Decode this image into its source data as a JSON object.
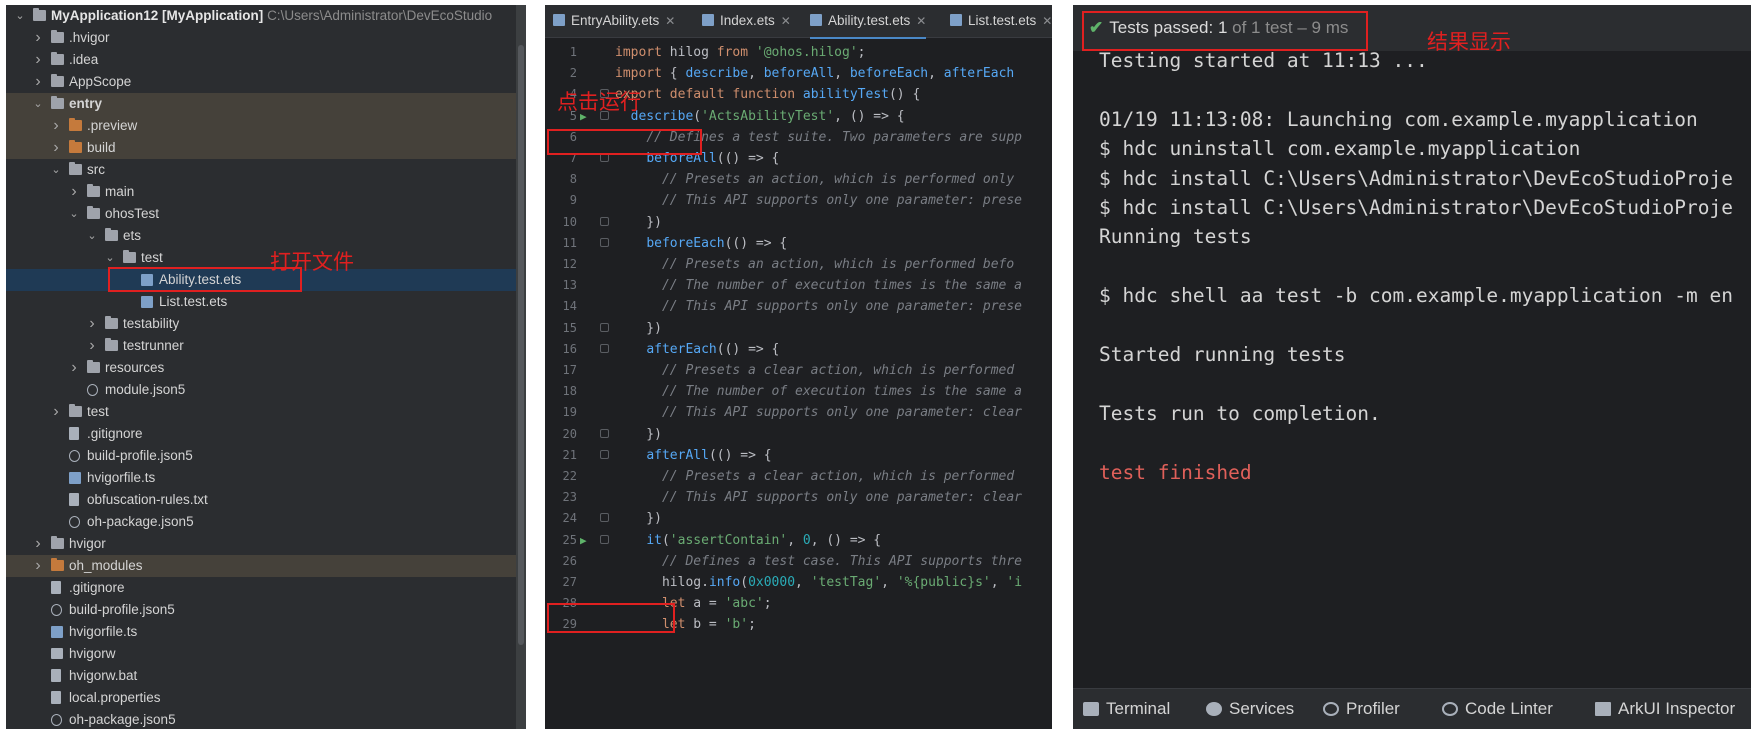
{
  "project_tree": {
    "root_name": "MyApplication12",
    "root_module": "[MyApplication]",
    "root_path": "C:\\Users\\Administrator\\DevEcoStudio",
    "items": [
      {
        "label": ".hvigor",
        "icon": "folder-icon"
      },
      {
        "label": ".idea",
        "icon": "folder-icon"
      },
      {
        "label": "AppScope",
        "icon": "folder-icon"
      },
      {
        "label": "entry",
        "icon": "folder-icon"
      },
      {
        "label": ".preview",
        "icon": "folder-orange-icon"
      },
      {
        "label": "build",
        "icon": "folder-orange-icon"
      },
      {
        "label": "src",
        "icon": "folder-icon"
      },
      {
        "label": "main",
        "icon": "folder-icon"
      },
      {
        "label": "ohosTest",
        "icon": "folder-icon"
      },
      {
        "label": "ets",
        "icon": "folder-icon"
      },
      {
        "label": "test",
        "icon": "folder-icon"
      },
      {
        "label": "Ability.test.ets",
        "icon": "ets-file-icon"
      },
      {
        "label": "List.test.ets",
        "icon": "ets-file-icon"
      },
      {
        "label": "testability",
        "icon": "folder-icon"
      },
      {
        "label": "testrunner",
        "icon": "folder-icon"
      },
      {
        "label": "resources",
        "icon": "folder-icon"
      },
      {
        "label": "module.json5",
        "icon": "json-file-icon"
      },
      {
        "label": "test",
        "icon": "folder-icon"
      },
      {
        "label": ".gitignore",
        "icon": "file-icon"
      },
      {
        "label": "build-profile.json5",
        "icon": "json-file-icon"
      },
      {
        "label": "hvigorfile.ts",
        "icon": "ts-file-icon"
      },
      {
        "label": "obfuscation-rules.txt",
        "icon": "file-icon"
      },
      {
        "label": "oh-package.json5",
        "icon": "json-file-icon"
      },
      {
        "label": "hvigor",
        "icon": "folder-icon"
      },
      {
        "label": "oh_modules",
        "icon": "folder-orange-icon"
      },
      {
        "label": ".gitignore",
        "icon": "file-icon"
      },
      {
        "label": "build-profile.json5",
        "icon": "json-file-icon"
      },
      {
        "label": "hvigorfile.ts",
        "icon": "ts-file-icon"
      },
      {
        "label": "hvigorw",
        "icon": "terminal-file-icon"
      },
      {
        "label": "hvigorw.bat",
        "icon": "file-icon"
      },
      {
        "label": "local.properties",
        "icon": "file-icon"
      },
      {
        "label": "oh-package.json5",
        "icon": "json-file-icon"
      }
    ]
  },
  "editor": {
    "tabs": [
      "EntryAbility.ets",
      "Index.ets",
      "Ability.test.ets",
      "List.test.ets"
    ],
    "active_tab": "Ability.test.ets",
    "lines": [
      {
        "n": "1",
        "code": "import hilog from '@ohos.hilog';"
      },
      {
        "n": "2",
        "code": "import { describe, beforeAll, beforeEach, afterEach"
      },
      {
        "n": "4",
        "code": "export default function abilityTest() {"
      },
      {
        "n": "5",
        "code": "  describe('ActsAbilityTest', () => {"
      },
      {
        "n": "6",
        "code": "    // Defines a test suite. Two parameters are supp"
      },
      {
        "n": "7",
        "code": "    beforeAll(() => {"
      },
      {
        "n": "8",
        "code": "      // Presets an action, which is performed only"
      },
      {
        "n": "9",
        "code": "      // This API supports only one parameter: prese"
      },
      {
        "n": "10",
        "code": "    })"
      },
      {
        "n": "11",
        "code": "    beforeEach(() => {"
      },
      {
        "n": "12",
        "code": "      // Presets an action, which is performed befo"
      },
      {
        "n": "13",
        "code": "      // The number of execution times is the same a"
      },
      {
        "n": "14",
        "code": "      // This API supports only one parameter: prese"
      },
      {
        "n": "15",
        "code": "    })"
      },
      {
        "n": "16",
        "code": "    afterEach(() => {"
      },
      {
        "n": "17",
        "code": "      // Presets a clear action, which is performed"
      },
      {
        "n": "18",
        "code": "      // The number of execution times is the same a"
      },
      {
        "n": "19",
        "code": "      // This API supports only one parameter: clear"
      },
      {
        "n": "20",
        "code": "    })"
      },
      {
        "n": "21",
        "code": "    afterAll(() => {"
      },
      {
        "n": "22",
        "code": "      // Presets a clear action, which is performed"
      },
      {
        "n": "23",
        "code": "      // This API supports only one parameter: clear"
      },
      {
        "n": "24",
        "code": "    })"
      },
      {
        "n": "25",
        "code": "    it('assertContain', 0, () => {"
      },
      {
        "n": "26",
        "code": "      // Defines a test case. This API supports thre"
      },
      {
        "n": "27",
        "code": "      hilog.info(0x0000, 'testTag', '%{public}s', 'i"
      },
      {
        "n": "28",
        "code": "      let a = 'abc';"
      },
      {
        "n": "29",
        "code": "      let b = 'b';"
      }
    ]
  },
  "test_run": {
    "status_prefix": "Tests passed:",
    "passed_count": "1",
    "status_suffix": "of 1 test – 9 ms",
    "output": [
      "Testing started at 11:13 ...",
      "",
      "01/19 11:13:08: Launching com.example.myapplication",
      "$ hdc uninstall com.example.myapplication",
      "$ hdc install C:\\Users\\Administrator\\DevEcoStudioProje",
      "$ hdc install C:\\Users\\Administrator\\DevEcoStudioProje",
      "Running tests",
      "",
      "$ hdc shell aa test -b com.example.myapplication -m en",
      "",
      "Started running tests",
      "",
      "Tests run to completion.",
      "",
      "test finished"
    ],
    "tool_windows": [
      "Terminal",
      "Services",
      "Profiler",
      "Code Linter",
      "ArkUI Inspector"
    ]
  },
  "annotations": {
    "open_file": "打开文件",
    "click_run": "点击运行",
    "result_display": "结果显示"
  },
  "colors": {
    "annotation_red": "#e02020",
    "pass_green": "#5fb36a",
    "error_red": "#e0605a"
  }
}
